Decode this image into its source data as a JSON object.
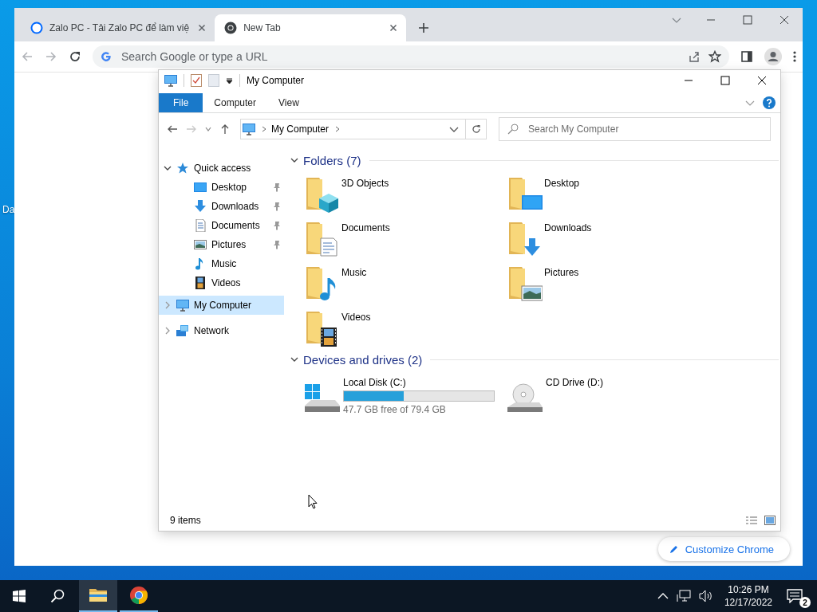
{
  "desktop": {
    "icons": [
      {
        "label": "Da"
      }
    ]
  },
  "browser": {
    "tabs": [
      {
        "title": "Zalo PC - Tải Zalo PC để làm việ",
        "selected": false
      },
      {
        "title": "New Tab",
        "selected": true
      }
    ],
    "omnibox": {
      "placeholder": "Search Google or type a URL"
    },
    "customize_button": "Customize Chrome"
  },
  "explorer": {
    "title": "My Computer",
    "ribbon_tabs": [
      {
        "label": "File",
        "selected": true
      },
      {
        "label": "Computer",
        "selected": false
      },
      {
        "label": "View",
        "selected": false
      }
    ],
    "address": {
      "path": "My Computer"
    },
    "search": {
      "placeholder": "Search My Computer"
    },
    "nav": [
      {
        "label": "Quick access",
        "expanded": true,
        "selected": false,
        "children": [
          {
            "label": "Desktop",
            "pinned": true,
            "selected": false
          },
          {
            "label": "Downloads",
            "pinned": true,
            "selected": false
          },
          {
            "label": "Documents",
            "pinned": true,
            "selected": false
          },
          {
            "label": "Pictures",
            "pinned": true,
            "selected": false
          },
          {
            "label": "Music",
            "pinned": false,
            "selected": false
          },
          {
            "label": "Videos",
            "pinned": false,
            "selected": false
          }
        ]
      },
      {
        "label": "My Computer",
        "expanded": false,
        "selected": true
      },
      {
        "label": "Network",
        "expanded": false,
        "selected": false
      }
    ],
    "sections": [
      {
        "title": "Folders (7)",
        "expanded": true,
        "items": [
          {
            "kind": "folder",
            "name": "3D Objects"
          },
          {
            "kind": "folder",
            "name": "Desktop"
          },
          {
            "kind": "folder",
            "name": "Documents"
          },
          {
            "kind": "folder",
            "name": "Downloads"
          },
          {
            "kind": "folder",
            "name": "Music"
          },
          {
            "kind": "folder",
            "name": "Pictures"
          },
          {
            "kind": "folder",
            "name": "Videos"
          }
        ]
      },
      {
        "title": "Devices and drives (2)",
        "expanded": true,
        "items": [
          {
            "kind": "drive",
            "name": "Local Disk (C:)",
            "level": 0.4,
            "free": "47.7 GB free of 79.4 GB"
          },
          {
            "kind": "drive",
            "name": "CD Drive (D:)"
          }
        ]
      }
    ],
    "status": "9 items"
  },
  "taskbar": {
    "apps": [
      {
        "selected": true
      },
      {
        "selected": false
      }
    ],
    "time": "10:26 PM",
    "date": "12/17/2022",
    "notifications": "2"
  }
}
